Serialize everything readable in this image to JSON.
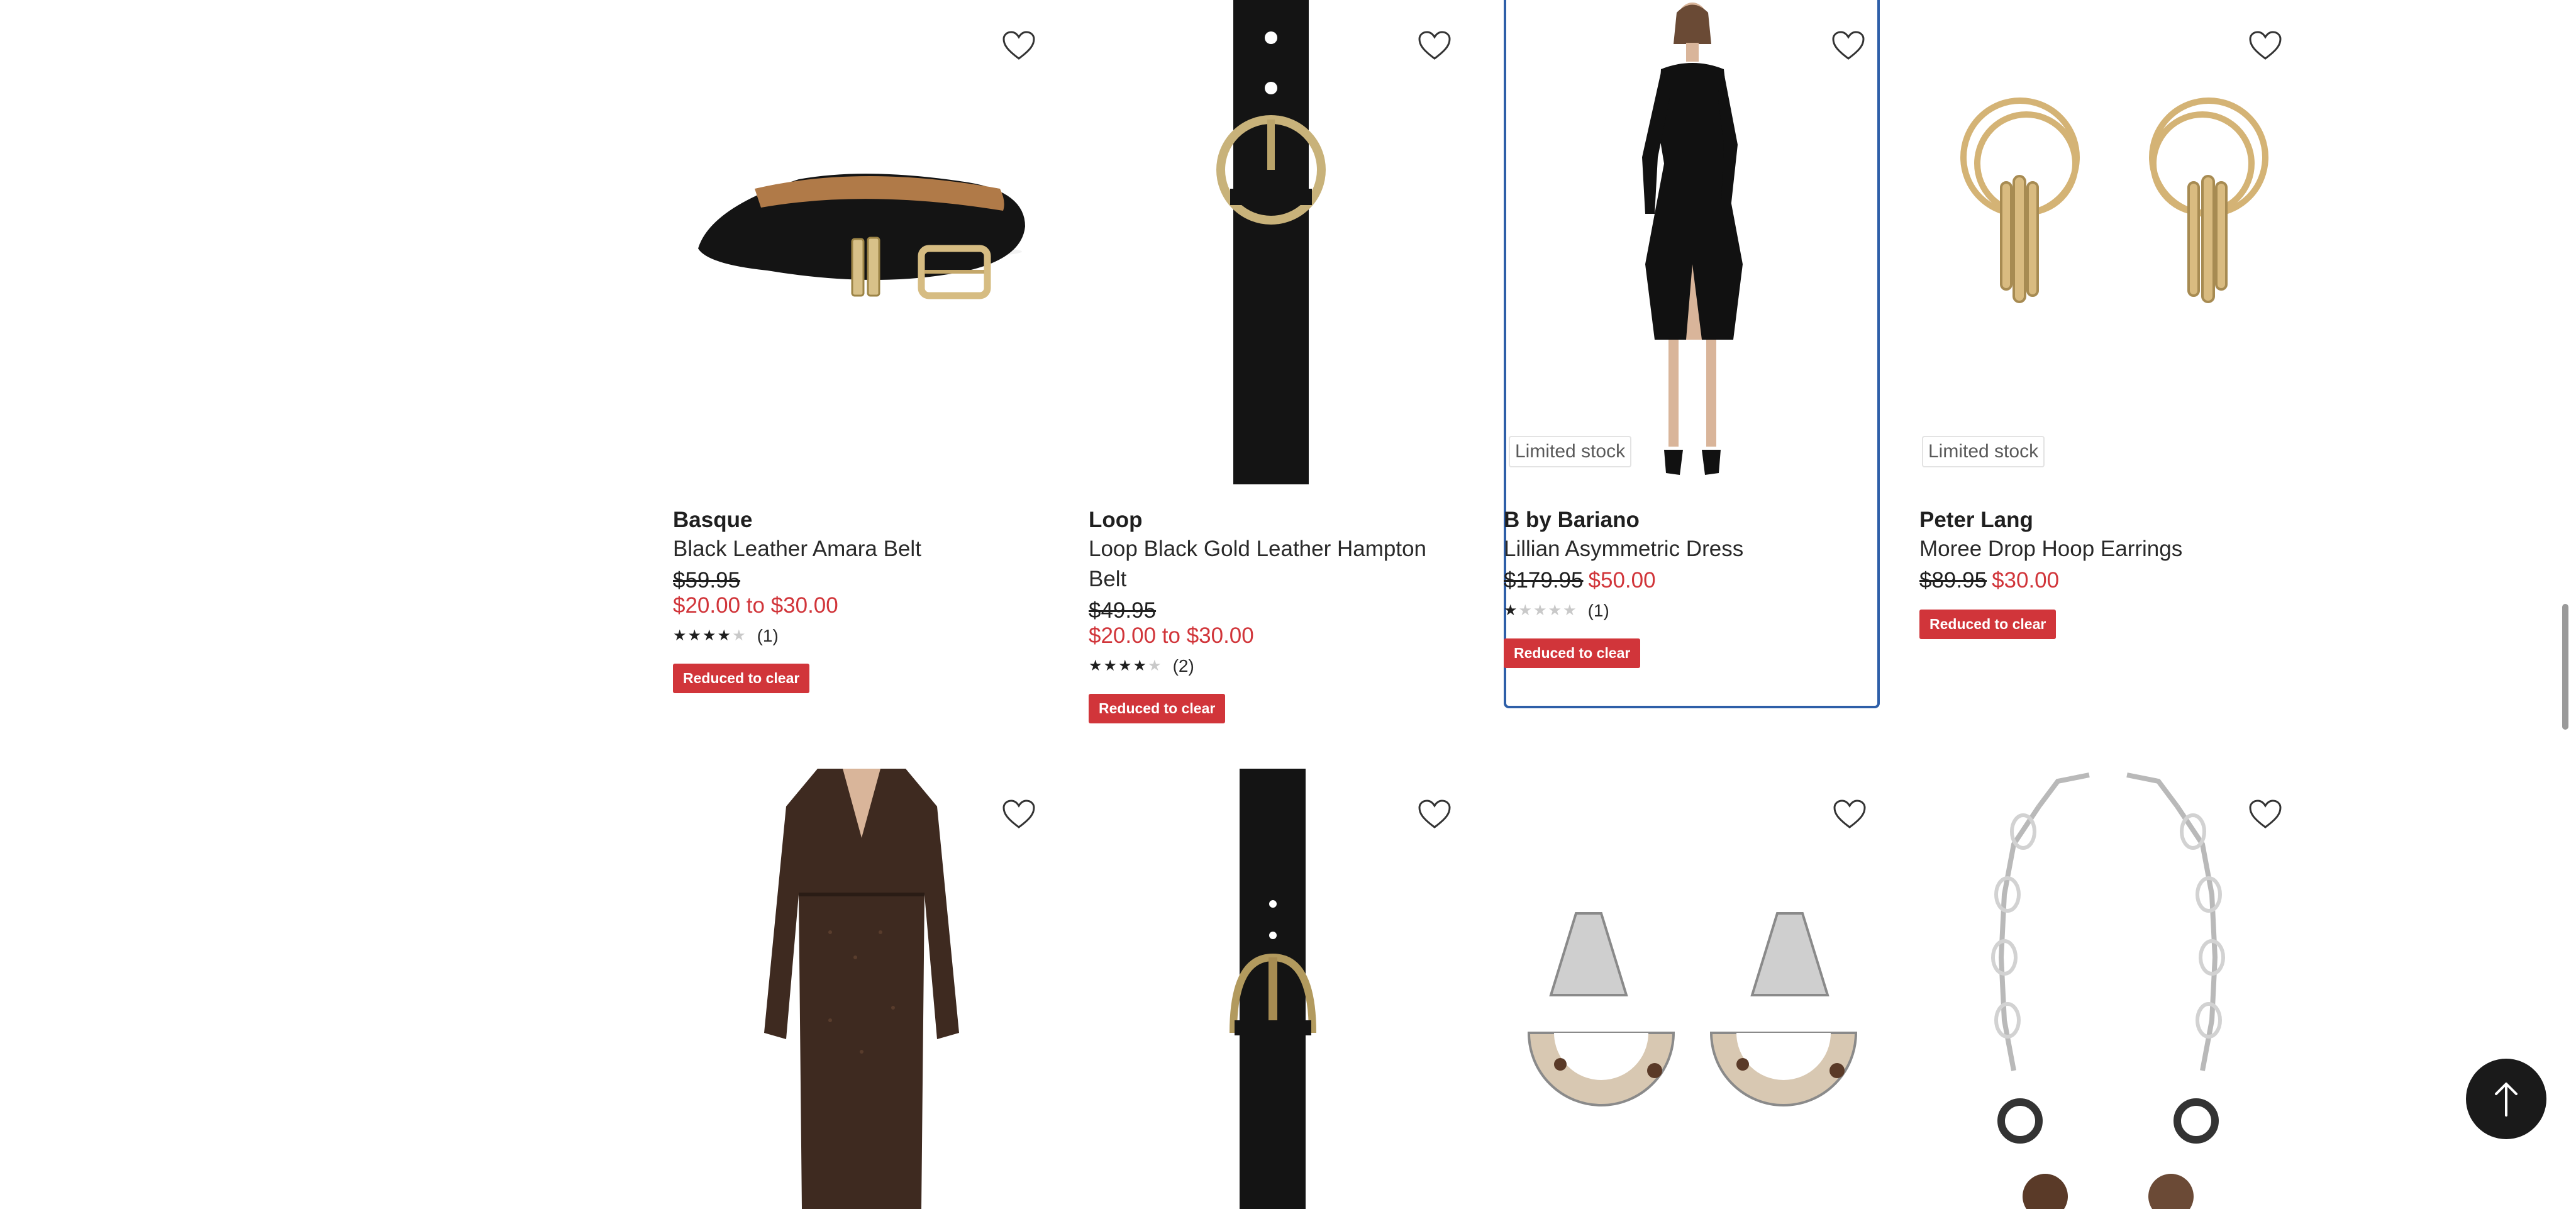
{
  "products": [
    {
      "brand": "Basque",
      "title": "Black Leather Amara Belt",
      "was_price": "$59.95",
      "now_price": "$20.00 to $30.00",
      "rating_stars": 4,
      "review_count": "(1)",
      "promo_tag": "Reduced to clear"
    },
    {
      "brand": "Loop",
      "title": "Loop Black Gold Leather Hampton Belt",
      "was_price": "$49.95",
      "now_price": "$20.00 to $30.00",
      "rating_stars": 4,
      "review_count": "(2)",
      "promo_tag": "Reduced to clear"
    },
    {
      "stock_badge": "Limited stock",
      "brand": "B by Bariano",
      "title": "Lillian Asymmetric Dress",
      "was_price": "$179.95",
      "now_price": "$50.00",
      "rating_stars": 1,
      "review_count": "(1)",
      "promo_tag": "Reduced to clear"
    },
    {
      "stock_badge": "Limited stock",
      "brand": "Peter Lang",
      "title": "Moree Drop Hoop Earrings",
      "was_price": "$89.95",
      "now_price": "$30.00",
      "promo_tag": "Reduced to clear"
    }
  ],
  "row2_images": [
    "patterned-wrap-dress",
    "black-leather-belt",
    "silver-tortoiseshell-earrings",
    "chain-link-necklace"
  ],
  "icons": {
    "wishlist": "heart-icon",
    "back_to_top": "arrow-up-icon"
  },
  "colors": {
    "sale_price": "#d1353a",
    "promo_tag_bg": "#d1353a",
    "focus_border": "#2e5fa8",
    "back_to_top_bg": "#1a1a1a"
  }
}
